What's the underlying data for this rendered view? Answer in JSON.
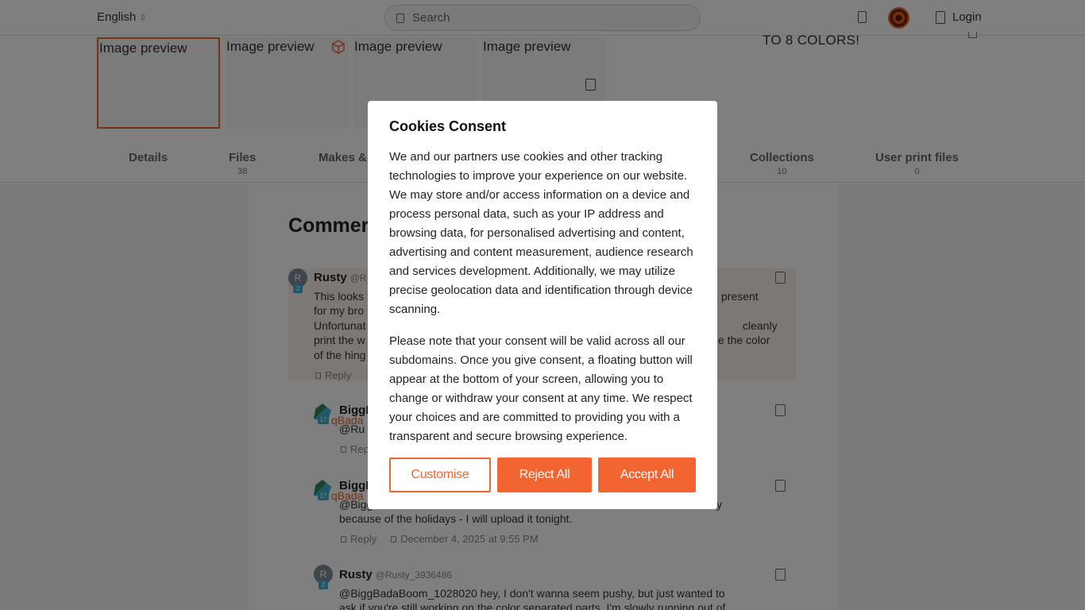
{
  "header": {
    "language": "English",
    "search_placeholder": "Search",
    "login_label": "Login"
  },
  "gallery": {
    "thumbnails": [
      "Image preview",
      "Image preview",
      "Image preview",
      "Image preview"
    ],
    "promo_text": "TO 8 COLORS!"
  },
  "tabs": [
    {
      "label": "Details",
      "count": ""
    },
    {
      "label": "Files",
      "count": "38"
    },
    {
      "label": "Makes &",
      "count": ""
    },
    {
      "label": "Collections",
      "count": "10"
    },
    {
      "label": "User print files",
      "count": "0"
    }
  ],
  "comments": {
    "title": "Commer",
    "items": [
      {
        "avatar_letter": "R",
        "level": "2",
        "author": "Rusty",
        "handle": "@R",
        "left_lines": [
          "This looks",
          "for my bro",
          "Unfortunat",
          "print the w",
          "of the hing"
        ],
        "right_lines": [
          "present",
          "",
          "cleanly",
          "e the color",
          ""
        ],
        "reply": "Reply"
      },
      {
        "level": "17",
        "author": "BiggB",
        "overlap": "qBada",
        "text": "@Ru",
        "reply": "Repl"
      },
      {
        "level": "17",
        "author": "BiggB",
        "overlap": "qBada",
        "line1_left": "@Bigg",
        "line1_right": "y",
        "line2": "because of the holidays - I will upload it tonight.",
        "reply": "Reply",
        "date": "December 4, 2025 at 9:55 PM"
      },
      {
        "avatar_letter": "R",
        "level": "2",
        "author": "Rusty",
        "handle": "@Rusty_3936486",
        "lines": [
          "@BiggBadaBoom_1028020 hey, I don't wanna seem pushy, but just wanted to",
          "ask if you're still working on the color separated parts. I'm slowly running out of"
        ]
      }
    ]
  },
  "cookie_modal": {
    "title": "Cookies Consent",
    "paragraph1": "We and our partners use cookies and other tracking technologies to improve your experience on our website. We may store and/or access information on a device and process personal data, such as your IP address and browsing data, for personalised advertising and content, advertising and content measurement, audience research and services development. Additionally, we may utilize precise geolocation data and identification through device scanning.",
    "paragraph2": "Please note that your consent will be valid across all our subdomains. Once you give consent, a floating button will appear at the bottom of your screen, allowing you to change or withdraw your consent at any time. We respect your choices and are committed to providing you with a transparent and secure browsing experience.",
    "customise_label": "Customise",
    "reject_label": "Reject All",
    "accept_label": "Accept All"
  },
  "colors": {
    "accent": "#f26430",
    "highlight_comment_bg": "#fdf0ea",
    "level_badge": "#3fb0d4"
  },
  "icons": [
    "dropdown-caret-icon",
    "search-icon",
    "bookmark-icon",
    "user-logo-icon",
    "user-icon",
    "cube-3d-icon",
    "flag-icon",
    "reply-icon",
    "clock-icon"
  ]
}
